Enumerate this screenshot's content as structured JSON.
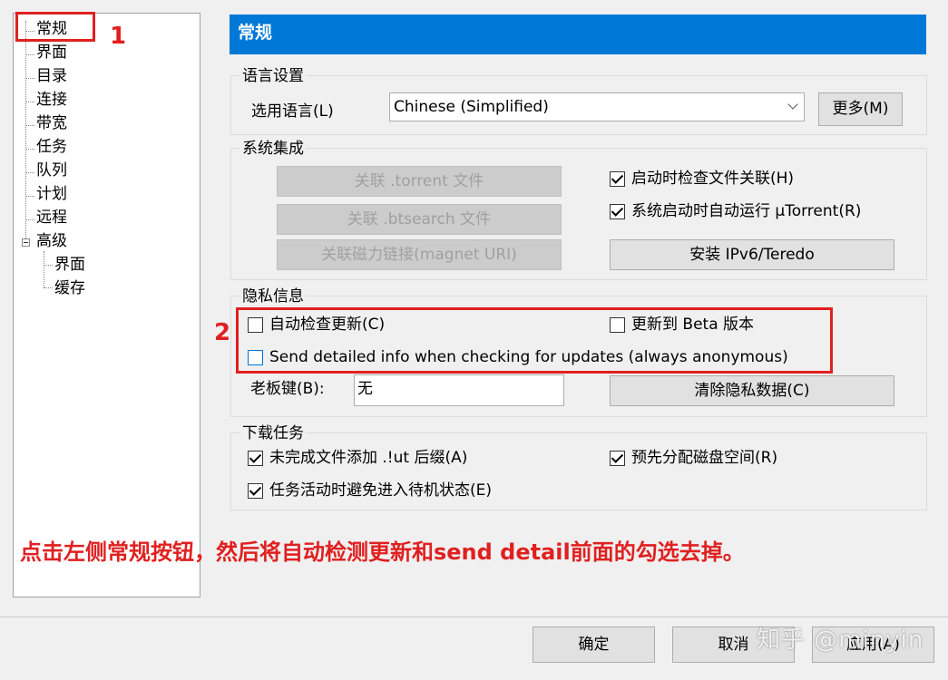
{
  "tree": {
    "items": [
      "常规",
      "界面",
      "目录",
      "连接",
      "带宽",
      "任务",
      "队列",
      "计划",
      "远程",
      "高级"
    ],
    "advanced_children": [
      "界面",
      "缓存"
    ]
  },
  "header": {
    "title": "常规"
  },
  "language": {
    "group_title": "语言设置",
    "select_label": "选用语言(L)",
    "selected": "Chinese (Simplified)",
    "more_button": "更多(M)"
  },
  "system": {
    "group_title": "系统集成",
    "assoc_torrent": "关联 .torrent 文件",
    "assoc_btsearch": "关联 .btsearch 文件",
    "assoc_magnet": "关联磁力链接(magnet URI)",
    "check_assoc_startup": {
      "label": "启动时检查文件关联(H)",
      "checked": true
    },
    "auto_run": {
      "label": "系统启动时自动运行 µTorrent(R)",
      "checked": true
    },
    "install_ipv6": "安装 IPv6/Teredo"
  },
  "privacy": {
    "group_title": "隐私信息",
    "auto_check_updates": {
      "label": "自动检查更新(C)",
      "checked": false
    },
    "update_beta": {
      "label": "更新到 Beta 版本",
      "checked": false
    },
    "send_info": {
      "label": "Send detailed info when checking for updates (always anonymous)",
      "checked": false
    },
    "boss_key_label": "老板键(B):",
    "boss_key_value": "无",
    "clear_privacy": "清除隐私数据(C)"
  },
  "downloads": {
    "group_title": "下载任务",
    "append_ut": {
      "label": "未完成文件添加 .!ut 后缀(A)",
      "checked": true
    },
    "prealloc": {
      "label": "预先分配磁盘空间(R)",
      "checked": true
    },
    "prevent_standby": {
      "label": "任务活动时避免进入待机状态(E)",
      "checked": true
    }
  },
  "annotations": {
    "marker1": "1",
    "marker2": "2",
    "instruction": "点击左侧常规按钮，然后将自动检测更新和send detail前面的勾选去掉。",
    "color": "#e02020"
  },
  "footer": {
    "ok": "确定",
    "cancel": "取消",
    "apply": "应用(A)"
  },
  "watermark": "知乎 @minyin",
  "colors": {
    "header_bg": "#0078d7",
    "annotation": "#e02020"
  }
}
